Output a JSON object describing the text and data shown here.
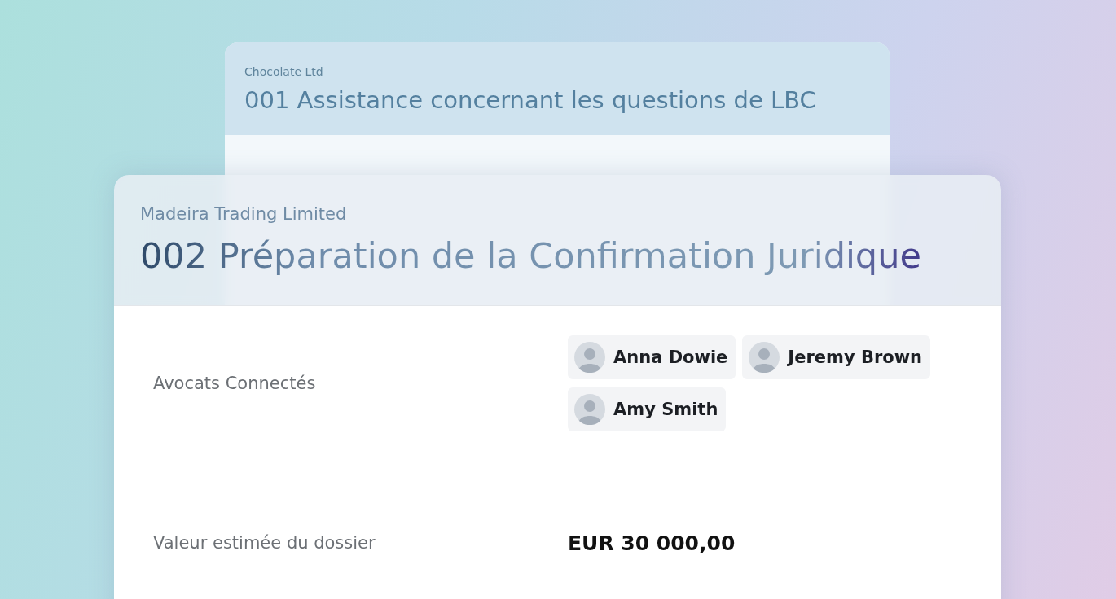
{
  "background_card": {
    "company": "Chocolate Ltd",
    "title": "001 Assistance concernant les questions de LBC"
  },
  "case_card": {
    "company": "Madeira Trading Limited",
    "title": "002 Préparation de la Confirmation Juridique",
    "fields": [
      {
        "label": "Avocats Connectés",
        "kind": "people",
        "people": [
          {
            "name": "Anna Dowie"
          },
          {
            "name": "Jeremy Brown"
          },
          {
            "name": "Amy Smith"
          }
        ]
      },
      {
        "label": "Valeur estimée du dossier",
        "kind": "amount",
        "value": "EUR 30 000,00"
      }
    ]
  }
}
